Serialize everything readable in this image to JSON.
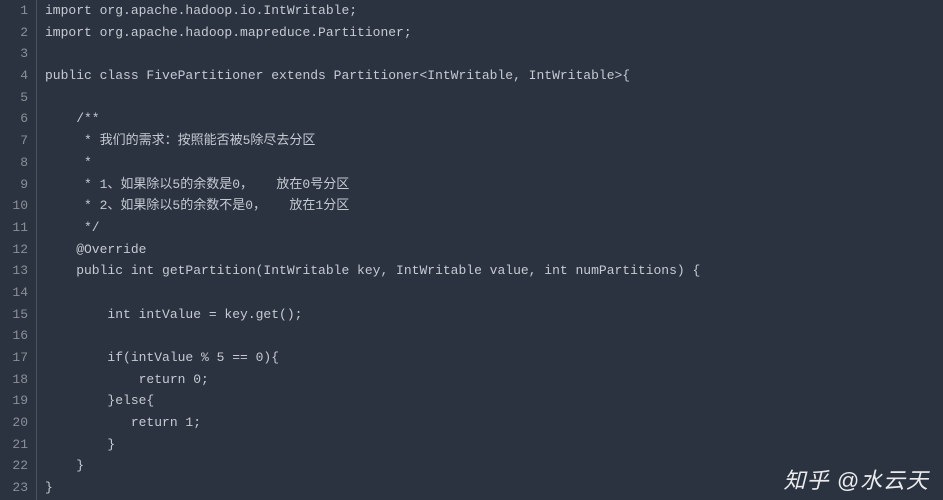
{
  "code": {
    "lines": [
      {
        "n": 1,
        "text": "import org.apache.hadoop.io.IntWritable;"
      },
      {
        "n": 2,
        "text": "import org.apache.hadoop.mapreduce.Partitioner;"
      },
      {
        "n": 3,
        "text": ""
      },
      {
        "n": 4,
        "text": "public class FivePartitioner extends Partitioner<IntWritable, IntWritable>{"
      },
      {
        "n": 5,
        "text": ""
      },
      {
        "n": 6,
        "text": "    /**"
      },
      {
        "n": 7,
        "text": "     * 我们的需求：按照能否被5除尽去分区"
      },
      {
        "n": 8,
        "text": "     *"
      },
      {
        "n": 9,
        "text": "     * 1、如果除以5的余数是0，   放在0号分区"
      },
      {
        "n": 10,
        "text": "     * 2、如果除以5的余数不是0，   放在1分区"
      },
      {
        "n": 11,
        "text": "     */"
      },
      {
        "n": 12,
        "text": "    @Override"
      },
      {
        "n": 13,
        "text": "    public int getPartition(IntWritable key, IntWritable value, int numPartitions) {"
      },
      {
        "n": 14,
        "text": ""
      },
      {
        "n": 15,
        "text": "        int intValue = key.get();"
      },
      {
        "n": 16,
        "text": ""
      },
      {
        "n": 17,
        "text": "        if(intValue % 5 == 0){"
      },
      {
        "n": 18,
        "text": "            return 0;"
      },
      {
        "n": 19,
        "text": "        }else{"
      },
      {
        "n": 20,
        "text": "           return 1;"
      },
      {
        "n": 21,
        "text": "        }"
      },
      {
        "n": 22,
        "text": "    }"
      },
      {
        "n": 23,
        "text": "}"
      }
    ]
  },
  "watermark": "知乎 @水云天"
}
